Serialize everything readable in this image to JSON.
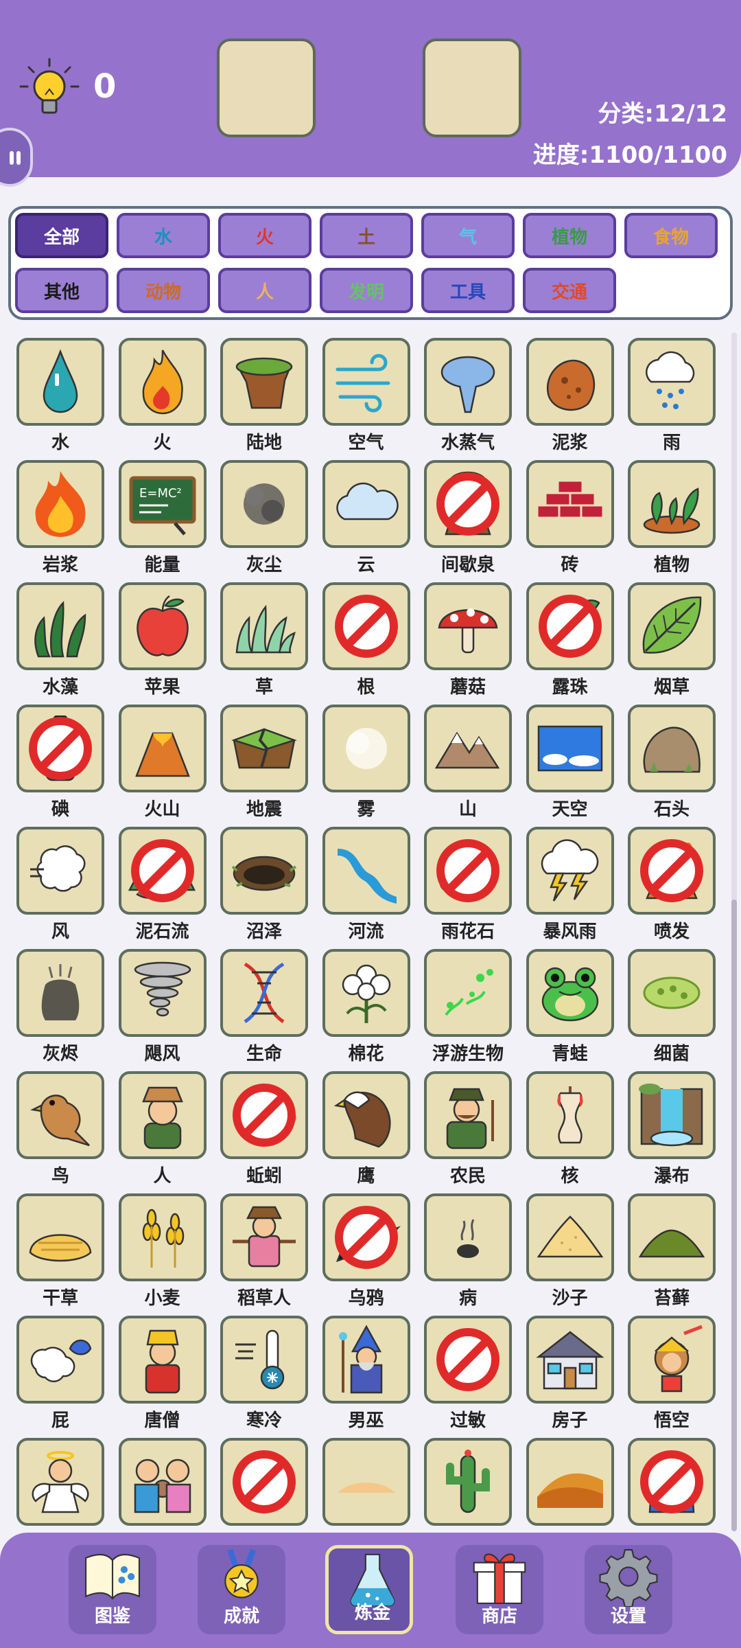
{
  "header": {
    "hint_count": "0",
    "category_stat": "分类:12/12",
    "progress_stat": "进度:1100/1100"
  },
  "filters": [
    {
      "label": "全部",
      "color": "#ffffff",
      "active": true
    },
    {
      "label": "水",
      "color": "#1d8fbf"
    },
    {
      "label": "火",
      "color": "#e0362a"
    },
    {
      "label": "土",
      "color": "#8a4f2b"
    },
    {
      "label": "气",
      "color": "#5bc4e6"
    },
    {
      "label": "植物",
      "color": "#3a9a4a"
    },
    {
      "label": "食物",
      "color": "#e8a533"
    },
    {
      "label": "其他",
      "color": "#1a1a1a"
    },
    {
      "label": "动物",
      "color": "#d06a1f"
    },
    {
      "label": "人",
      "color": "#f0b060"
    },
    {
      "label": "发明",
      "color": "#66c266"
    },
    {
      "label": "工具",
      "color": "#2747b8"
    },
    {
      "label": "交通",
      "color": "#e04a2a"
    }
  ],
  "elements": [
    {
      "label": "水",
      "icon": "water-drop-icon"
    },
    {
      "label": "火",
      "icon": "fire-icon"
    },
    {
      "label": "陆地",
      "icon": "land-icon"
    },
    {
      "label": "空气",
      "icon": "air-icon"
    },
    {
      "label": "水蒸气",
      "icon": "steam-icon"
    },
    {
      "label": "泥浆",
      "icon": "mud-icon"
    },
    {
      "label": "雨",
      "icon": "rain-icon"
    },
    {
      "label": "岩浆",
      "icon": "lava-icon"
    },
    {
      "label": "能量",
      "icon": "energy-icon"
    },
    {
      "label": "灰尘",
      "icon": "dust-icon"
    },
    {
      "label": "云",
      "icon": "cloud-icon"
    },
    {
      "label": "间歇泉",
      "icon": "geyser-icon",
      "banned": true
    },
    {
      "label": "砖",
      "icon": "brick-icon"
    },
    {
      "label": "植物",
      "icon": "plant-icon"
    },
    {
      "label": "水藻",
      "icon": "algae-icon"
    },
    {
      "label": "苹果",
      "icon": "apple-icon"
    },
    {
      "label": "草",
      "icon": "grass-icon"
    },
    {
      "label": "根",
      "icon": "root-icon",
      "banned": true
    },
    {
      "label": "蘑菇",
      "icon": "mushroom-icon"
    },
    {
      "label": "露珠",
      "icon": "dew-icon",
      "banned": true
    },
    {
      "label": "烟草",
      "icon": "tobacco-icon"
    },
    {
      "label": "碘",
      "icon": "iodine-icon",
      "banned": true
    },
    {
      "label": "火山",
      "icon": "volcano-icon"
    },
    {
      "label": "地震",
      "icon": "earthquake-icon"
    },
    {
      "label": "雾",
      "icon": "fog-icon"
    },
    {
      "label": "山",
      "icon": "mountain-icon"
    },
    {
      "label": "天空",
      "icon": "sky-icon"
    },
    {
      "label": "石头",
      "icon": "stone-icon"
    },
    {
      "label": "风",
      "icon": "wind-icon"
    },
    {
      "label": "泥石流",
      "icon": "mudslide-icon",
      "banned": true
    },
    {
      "label": "沼泽",
      "icon": "swamp-icon"
    },
    {
      "label": "河流",
      "icon": "river-icon"
    },
    {
      "label": "雨花石",
      "icon": "pebbles-icon",
      "banned": true
    },
    {
      "label": "暴风雨",
      "icon": "storm-icon"
    },
    {
      "label": "喷发",
      "icon": "eruption-icon",
      "banned": true
    },
    {
      "label": "灰烬",
      "icon": "ash-icon"
    },
    {
      "label": "飓风",
      "icon": "tornado-icon"
    },
    {
      "label": "生命",
      "icon": "dna-icon"
    },
    {
      "label": "棉花",
      "icon": "cotton-icon"
    },
    {
      "label": "浮游生物",
      "icon": "plankton-icon"
    },
    {
      "label": "青蛙",
      "icon": "frog-icon"
    },
    {
      "label": "细菌",
      "icon": "bacteria-icon"
    },
    {
      "label": "鸟",
      "icon": "bird-icon"
    },
    {
      "label": "人",
      "icon": "human-icon"
    },
    {
      "label": "蚯蚓",
      "icon": "worm-icon",
      "banned": true
    },
    {
      "label": "鹰",
      "icon": "eagle-icon"
    },
    {
      "label": "农民",
      "icon": "farmer-icon"
    },
    {
      "label": "核",
      "icon": "apple-core-icon"
    },
    {
      "label": "瀑布",
      "icon": "waterfall-icon"
    },
    {
      "label": "干草",
      "icon": "hay-icon"
    },
    {
      "label": "小麦",
      "icon": "wheat-icon"
    },
    {
      "label": "稻草人",
      "icon": "scarecrow-icon"
    },
    {
      "label": "乌鸦",
      "icon": "crow-icon",
      "banned": true
    },
    {
      "label": "病",
      "icon": "sick-icon"
    },
    {
      "label": "沙子",
      "icon": "sand-icon"
    },
    {
      "label": "苔藓",
      "icon": "moss-icon"
    },
    {
      "label": "屁",
      "icon": "fart-icon"
    },
    {
      "label": "唐僧",
      "icon": "monk-icon"
    },
    {
      "label": "寒冷",
      "icon": "cold-icon"
    },
    {
      "label": "男巫",
      "icon": "wizard-icon"
    },
    {
      "label": "过敏",
      "icon": "allergy-icon",
      "banned": true
    },
    {
      "label": "房子",
      "icon": "house-icon"
    },
    {
      "label": "悟空",
      "icon": "monkey-king-icon"
    },
    {
      "label": "",
      "icon": "angel-icon"
    },
    {
      "label": "",
      "icon": "family-icon"
    },
    {
      "label": "",
      "icon": "fly-icon",
      "banned": true
    },
    {
      "label": "",
      "icon": "sand-pile-icon"
    },
    {
      "label": "",
      "icon": "cactus-icon"
    },
    {
      "label": "",
      "icon": "desert-icon"
    },
    {
      "label": "",
      "icon": "pharaoh-icon",
      "banned": true
    }
  ],
  "bottom_nav": [
    {
      "label": "图鉴",
      "icon": "book-icon"
    },
    {
      "label": "成就",
      "icon": "medal-icon"
    },
    {
      "label": "炼金",
      "icon": "flask-icon",
      "active": true
    },
    {
      "label": "商店",
      "icon": "gift-icon"
    },
    {
      "label": "设置",
      "icon": "gear-icon"
    }
  ]
}
